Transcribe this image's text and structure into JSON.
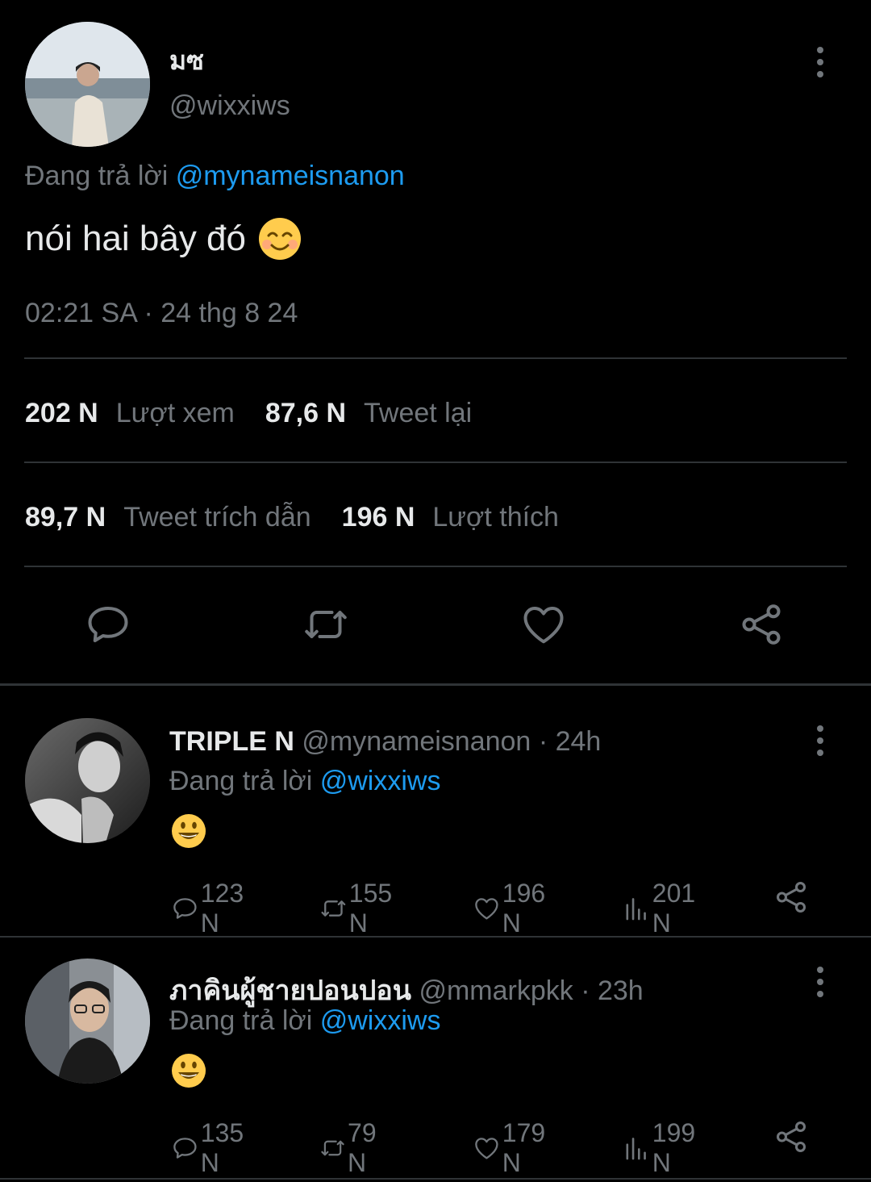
{
  "main_tweet": {
    "display_name": "มซ",
    "handle": "@wixxiws",
    "replying_prefix": "Đang trả lời",
    "replying_to": "@mynameisnanon",
    "text": "nói hai bây đó",
    "emoji": "☺️",
    "timestamp": "02:21 SA · 24 thg 8 24",
    "stats": {
      "views_count": "202 N",
      "views_label": "Lượt xem",
      "retweets_count": "87,6 N",
      "retweets_label": "Tweet lại",
      "quotes_count": "89,7 N",
      "quotes_label": "Tweet trích dẫn",
      "likes_count": "196 N",
      "likes_label": "Lượt thích"
    }
  },
  "replies": [
    {
      "display_name": "TRIPLE N",
      "handle": "@mynameisnanon",
      "time": "· 24h",
      "replying_prefix": "Đang trả lời",
      "replying_to": "@wixxiws",
      "emoji": "😃",
      "replies": "123 N",
      "retweets": "155 N",
      "likes": "196 N",
      "views": "201 N"
    },
    {
      "display_name": "ภาคินผู้ชายปอนปอน",
      "handle": "@mmarkpkk",
      "time": "· 23h",
      "replying_prefix": "Đang trả lời",
      "replying_to": "@wixxiws",
      "emoji": "😃",
      "replies": "135 N",
      "retweets": "79 N",
      "likes": "179 N",
      "views": "199 N"
    }
  ],
  "colors": {
    "background": "#000000",
    "text": "#e7e9ea",
    "secondary": "#71767b",
    "link": "#1d9bf0",
    "divider": "#2f3336"
  }
}
